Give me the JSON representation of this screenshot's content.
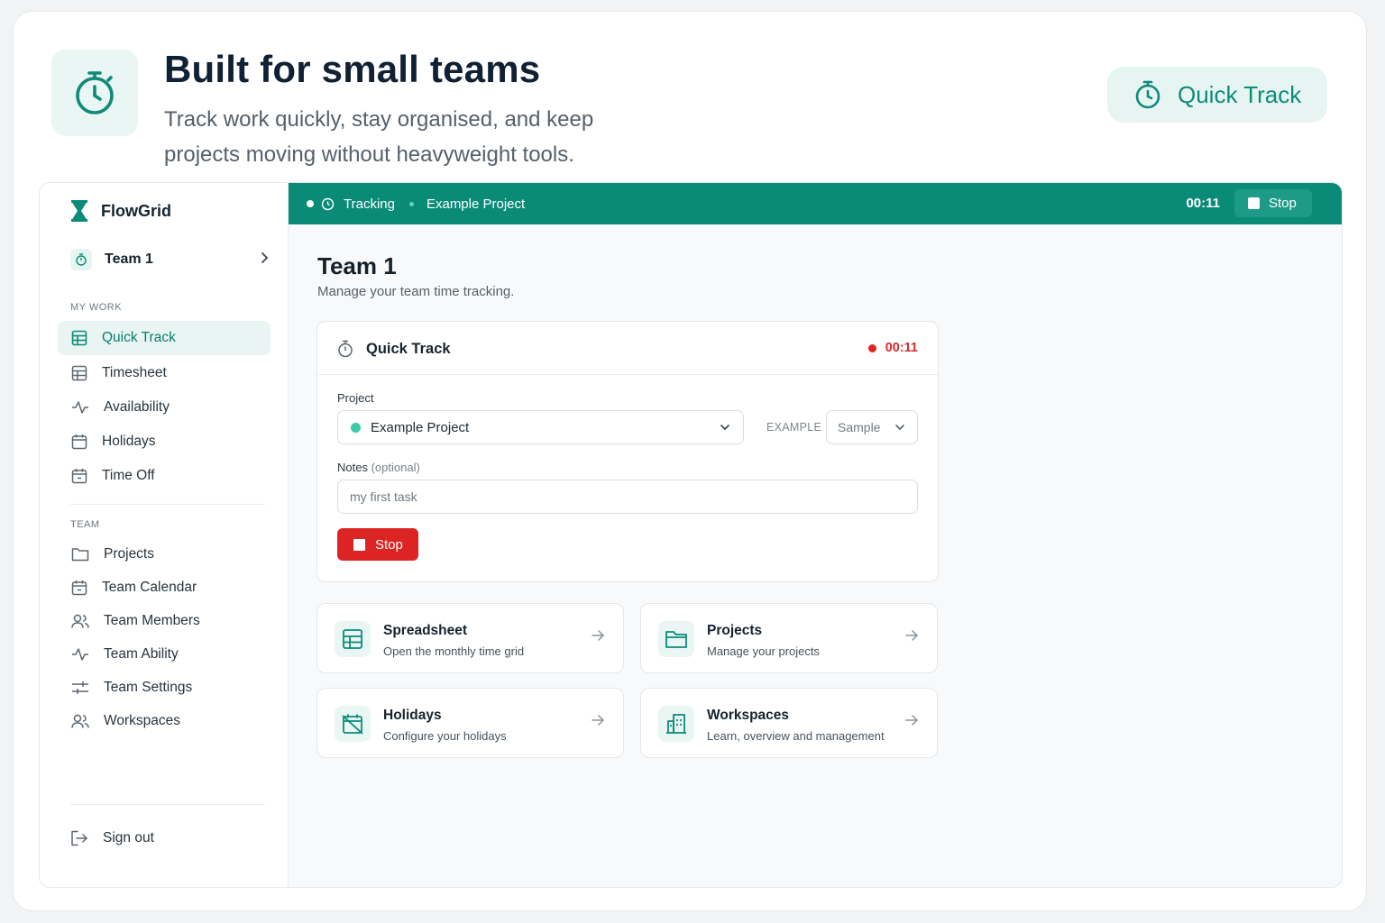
{
  "hero": {
    "title": "Built for small teams",
    "subtitle": "Track work quickly, stay organised, and keep projects moving without heavyweight tools.",
    "badge_label": "Quick Track",
    "icon": "stopwatch-icon"
  },
  "sidebar": {
    "brand": "FlowGrid",
    "team_name": "Team 1",
    "my_work_label": "MY WORK",
    "my_work_items": [
      {
        "label": "Quick Track",
        "icon": "table-icon",
        "active": true
      },
      {
        "label": "Timesheet",
        "icon": "table-icon"
      },
      {
        "label": "Availability",
        "icon": "activity-icon"
      },
      {
        "label": "Holidays",
        "icon": "calendar-icon"
      },
      {
        "label": "Time Off",
        "icon": "calendar-icon"
      }
    ],
    "team_label": "TEAM",
    "team_items": [
      {
        "label": "Projects",
        "icon": "folder-icon"
      },
      {
        "label": "Team Calendar",
        "icon": "calendar-icon"
      },
      {
        "label": "Team Members",
        "icon": "users-icon"
      },
      {
        "label": "Team Ability",
        "icon": "activity-icon"
      },
      {
        "label": "Team Settings",
        "icon": "sliders-icon"
      },
      {
        "label": "Workspaces",
        "icon": "users-icon"
      }
    ],
    "signout": "Sign out"
  },
  "topbar": {
    "status": "Tracking",
    "project": "Example Project",
    "timer": "00:11",
    "stop_label": "Stop"
  },
  "main": {
    "title": "Team 1",
    "subtitle": "Manage your team time tracking."
  },
  "quick_track": {
    "title": "Quick Track",
    "timer": "00:11",
    "project_label": "Project",
    "project_value": "Example Project",
    "example_label": "EXAMPLE",
    "sample_value": "Sample",
    "notes_label": "Notes",
    "notes_optional": "(optional)",
    "notes_placeholder": "my first task",
    "stop_label": "Stop"
  },
  "tiles": [
    {
      "title": "Spreadsheet",
      "subtitle": "Open the monthly time grid",
      "icon": "table-icon"
    },
    {
      "title": "Projects",
      "subtitle": "Manage your projects",
      "icon": "folder-icon"
    },
    {
      "title": "Holidays",
      "subtitle": "Configure your holidays",
      "icon": "calendar-off-icon"
    },
    {
      "title": "Workspaces",
      "subtitle": "Learn, overview and management",
      "icon": "building-icon"
    }
  ],
  "colors": {
    "accent": "#0a8b78",
    "accent_light": "#e8f5f2",
    "danger": "#dd2424"
  }
}
